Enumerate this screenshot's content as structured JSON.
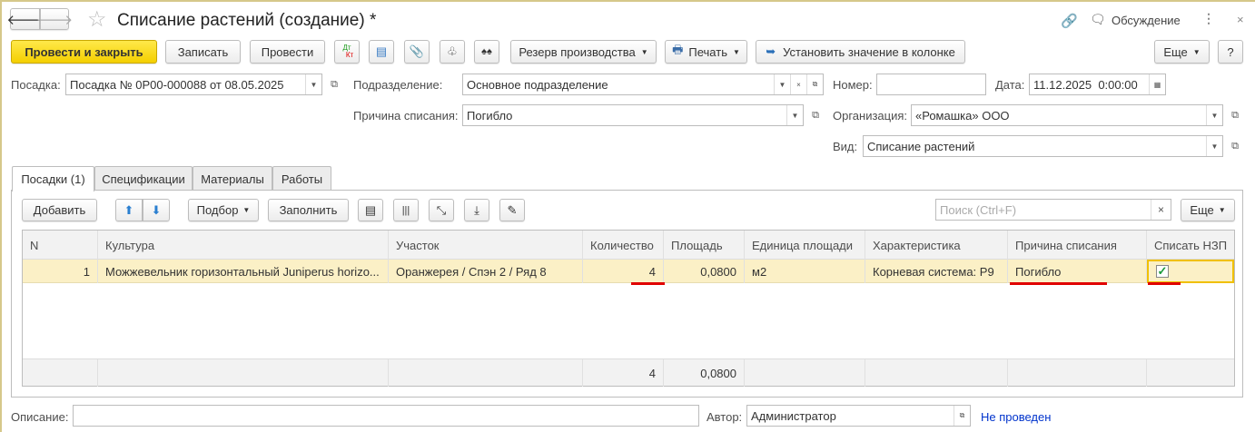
{
  "header": {
    "title": "Списание растений (создание) *",
    "discussion": "Обсуждение"
  },
  "toolbar": {
    "post_close": "Провести и закрыть",
    "save": "Записать",
    "post": "Провести",
    "dtkt_dt": "Дт",
    "dtkt_kt": "Кт",
    "reserve": "Резерв производства",
    "print": "Печать",
    "set_column": "Установить значение в колонке",
    "more": "Еще",
    "help": "?"
  },
  "form": {
    "planting_label": "Посадка:",
    "planting": "Посадка № 0Р00-000088 от 08.05.2025",
    "division_label": "Подразделение:",
    "division": "Основное подразделение",
    "number_label": "Номер:",
    "number": "",
    "date_label": "Дата:",
    "date": "11.12.2025  0:00:00",
    "reason_label": "Причина списания:",
    "reason": "Погибло",
    "org_label": "Организация:",
    "org": "«Ромашка» ООО",
    "kind_label": "Вид:",
    "kind": "Списание растений"
  },
  "tabs": [
    "Посадки (1)",
    "Спецификации",
    "Материалы",
    "Работы"
  ],
  "table_toolbar": {
    "add": "Добавить",
    "pick": "Подбор",
    "fill": "Заполнить",
    "search_placeholder": "Поиск (Ctrl+F)",
    "more": "Еще"
  },
  "table": {
    "columns": [
      "N",
      "Культура",
      "Участок",
      "Количество",
      "Площадь",
      "Единица площади",
      "Характеристика",
      "Причина списания",
      "Списать НЗП"
    ],
    "rows": [
      {
        "n": "1",
        "culture": "Можжевельник горизонтальный Juniperus horizo...",
        "plot": "Оранжерея / Спэн 2 / Ряд 8",
        "qty": "4",
        "area": "0,0800",
        "unit": "м2",
        "character": "Корневая система: Р9",
        "reason": "Погибло",
        "writeoff": true
      }
    ],
    "totals": {
      "qty": "4",
      "area": "0,0800"
    }
  },
  "footer": {
    "desc_label": "Описание:",
    "desc": "",
    "author_label": "Автор:",
    "author": "Администратор",
    "status": "Не проведен"
  },
  "colors": {
    "accent": "#f4cf00",
    "status": "#0033cc",
    "highlight": "#fbf0c6"
  }
}
